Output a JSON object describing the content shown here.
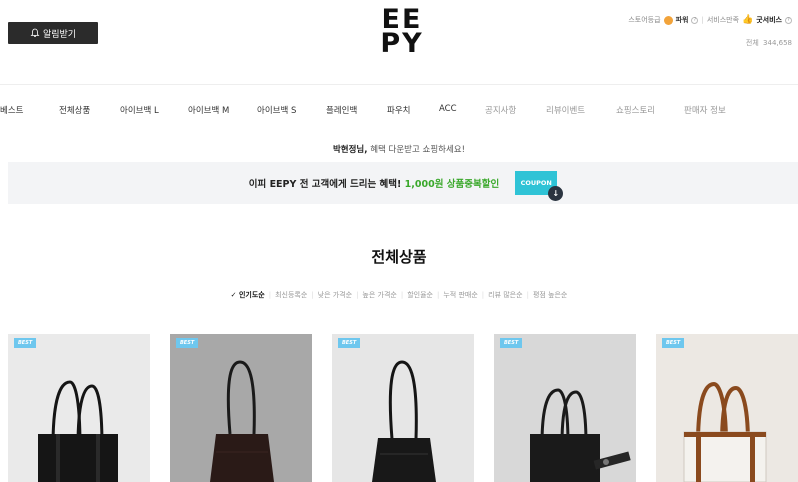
{
  "header": {
    "alert_label": "알림받기",
    "logo_line1": "EE",
    "logo_line2": "PY",
    "store_grade_label": "스토어등급",
    "store_grade": "파워",
    "service_label": "서비스만족",
    "service_value": "굿서비스",
    "visitors_label": "전체",
    "visitors_count": "344,658"
  },
  "nav": {
    "items": [
      "베스트",
      "전체상품",
      "아이브백 L",
      "아이브백 M",
      "아이브백 S",
      "플레인백",
      "파우치",
      "ACC",
      "공지사항",
      "리뷰이벤트",
      "쇼핑스토리",
      "판매자 정보"
    ]
  },
  "greeting": {
    "name": "박현정님,",
    "message": "혜택 다운받고 쇼핑하세요!"
  },
  "banner": {
    "text": "이피 EEPY 전 고객에게 드리는 혜택!",
    "highlight": "1,000원 상품중복할인",
    "coupon_label": "COUPON"
  },
  "section": {
    "title": "전체상품"
  },
  "sort": {
    "options": [
      "인기도순",
      "최신등록순",
      "낮은 가격순",
      "높은 가격순",
      "할인율순",
      "누적 판매순",
      "리뷰 많은순",
      "평점 높은순"
    ],
    "active_index": 0
  },
  "products": [
    {
      "badge": "BEST",
      "bg": "#eaeaea",
      "bag_color": "#151515",
      "handle_color": "#151515"
    },
    {
      "badge": "BEST",
      "bg": "#a8a8a8",
      "bag_color": "#2a1a17",
      "handle_color": "#1a1a1a"
    },
    {
      "badge": "BEST",
      "bg": "#e6e6e6",
      "bag_color": "#181818",
      "handle_color": "#151515"
    },
    {
      "badge": "BEST",
      "bg": "#d8d8d8",
      "bag_color": "#1a1a1a",
      "handle_color": "#1a1a1a"
    },
    {
      "badge": "BEST",
      "bg": "#ece8e3",
      "bag_color": "#f4f2ee",
      "handle_color": "#8a4a1e"
    }
  ],
  "colors": {
    "accent_green": "#3aa82b",
    "coupon_cyan": "#2fc3d6",
    "badge_blue": "#6ec7ee"
  }
}
